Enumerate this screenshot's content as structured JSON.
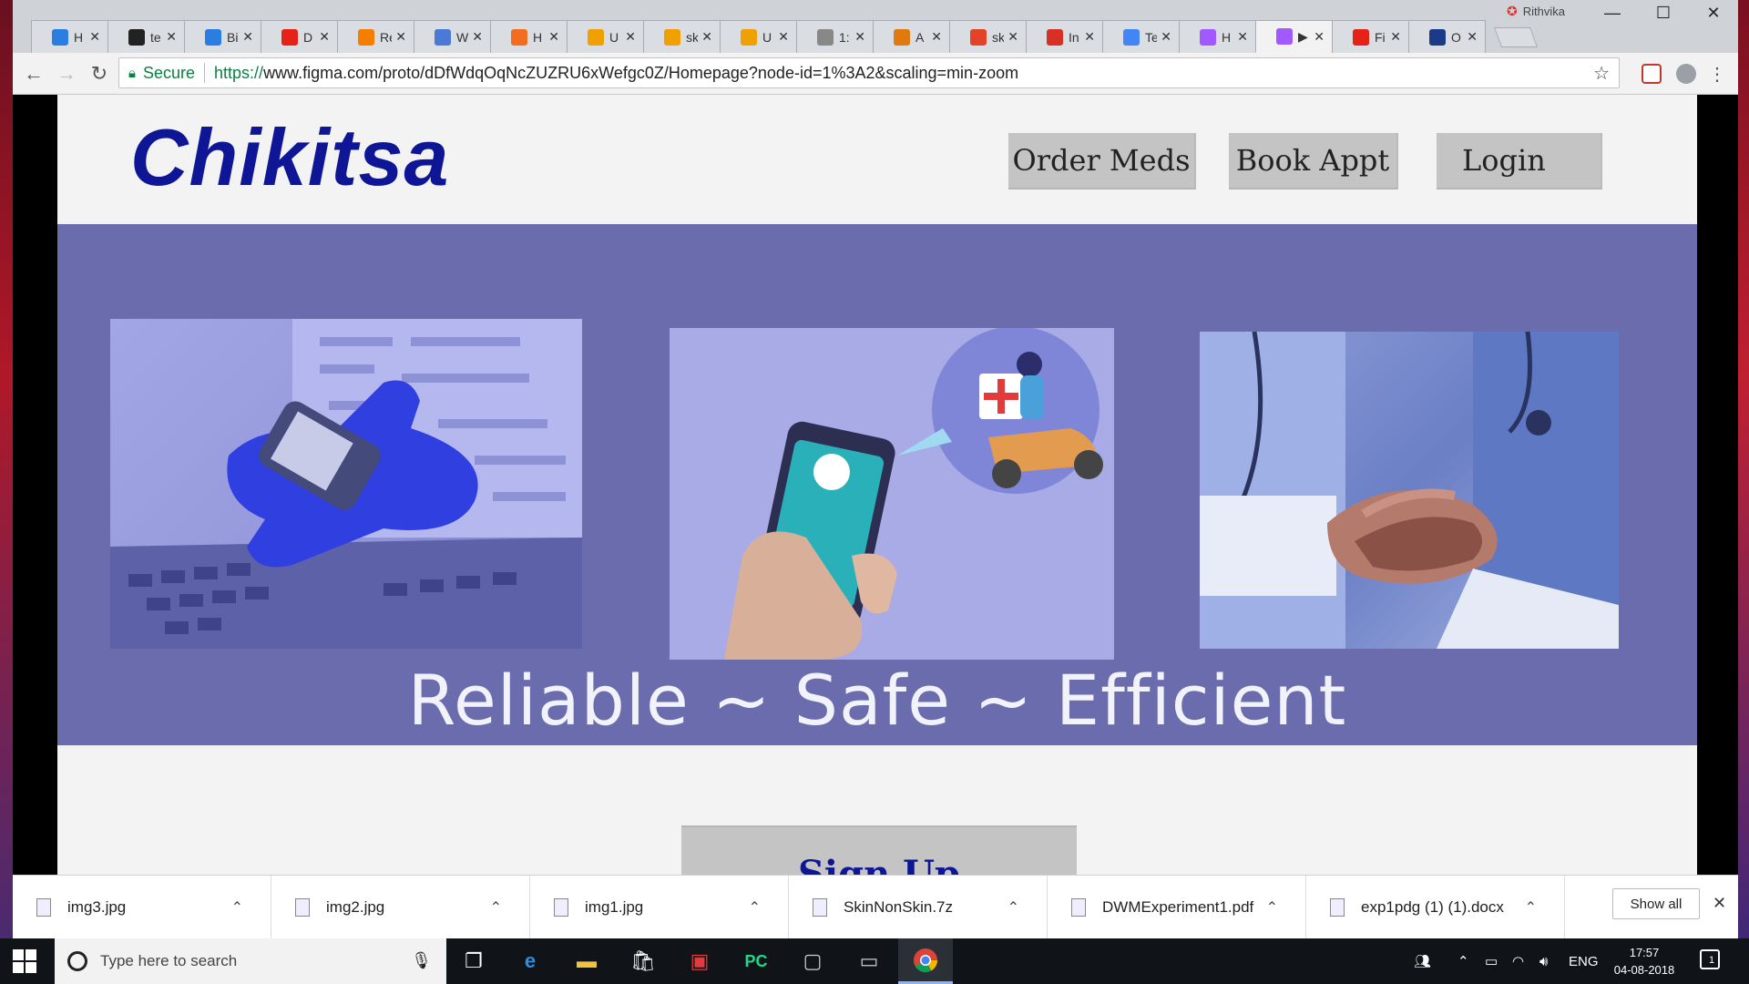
{
  "browser": {
    "tabs": [
      {
        "title": "H",
        "icon": "U",
        "color": "#2a7de1"
      },
      {
        "title": "te",
        "icon": "gh",
        "color": "#222222"
      },
      {
        "title": "Bi",
        "icon": "U",
        "color": "#2a7de1"
      },
      {
        "title": "D",
        "icon": "yt",
        "color": "#e62117"
      },
      {
        "title": "Re",
        "icon": "b",
        "color": "#f57d00"
      },
      {
        "title": "W",
        "icon": "∞",
        "color": "#4a7ad6"
      },
      {
        "title": "H",
        "icon": "◯",
        "color": "#f36d21"
      },
      {
        "title": "U",
        "icon": "◇",
        "color": "#f0a000"
      },
      {
        "title": "sk",
        "icon": "◇",
        "color": "#f0a000"
      },
      {
        "title": "U",
        "icon": "◇",
        "color": "#f0a000"
      },
      {
        "title": "1:",
        "icon": "doc",
        "color": "#888888"
      },
      {
        "title": "A",
        "icon": "m",
        "color": "#e07a10"
      },
      {
        "title": "sk",
        "icon": "gl",
        "color": "#e24329"
      },
      {
        "title": "In",
        "icon": "M",
        "color": "#d93025"
      },
      {
        "title": "Te",
        "icon": "≡",
        "color": "#4285f4"
      },
      {
        "title": "H",
        "icon": "F",
        "color": "#a259ff"
      },
      {
        "title": "▶",
        "icon": "F",
        "color": "#a259ff"
      },
      {
        "title": "Fi",
        "icon": "yt",
        "color": "#e62117"
      },
      {
        "title": "O",
        "icon": "p",
        "color": "#1b3a8a"
      }
    ],
    "active_tab_index": 16,
    "profile_name": "Rithvika",
    "secure_label": "Secure",
    "url_scheme": "https://",
    "url_host": "www.figma.com",
    "url_path": "/proto/dDfWdqOqNcZUZRU6xWefgc0Z/Homepage?node-id=1%3A2&scaling=min-zoom"
  },
  "site": {
    "logo": "Chikitsa",
    "nav": {
      "order_meds": "Order Meds",
      "book_appt": "Book Appt",
      "login": "Login"
    },
    "tagline": "Reliable ~ Safe ~ Efficient",
    "signup": "Sign Up"
  },
  "downloads": {
    "items": [
      {
        "name": "img3.jpg"
      },
      {
        "name": "img2.jpg"
      },
      {
        "name": "img1.jpg"
      },
      {
        "name": "SkinNonSkin.7z"
      },
      {
        "name": "DWMExperiment1.pdf"
      },
      {
        "name": "exp1pdg (1) (1).docx"
      }
    ],
    "show_all": "Show all"
  },
  "taskbar": {
    "search_placeholder": "Type here to search",
    "language": "ENG",
    "time": "17:57",
    "date": "04-08-2018",
    "notification_count": "1"
  },
  "colors": {
    "brand": "#0e1696",
    "hero_bg": "#6a6cae",
    "button_bg": "#c4c4c4"
  }
}
